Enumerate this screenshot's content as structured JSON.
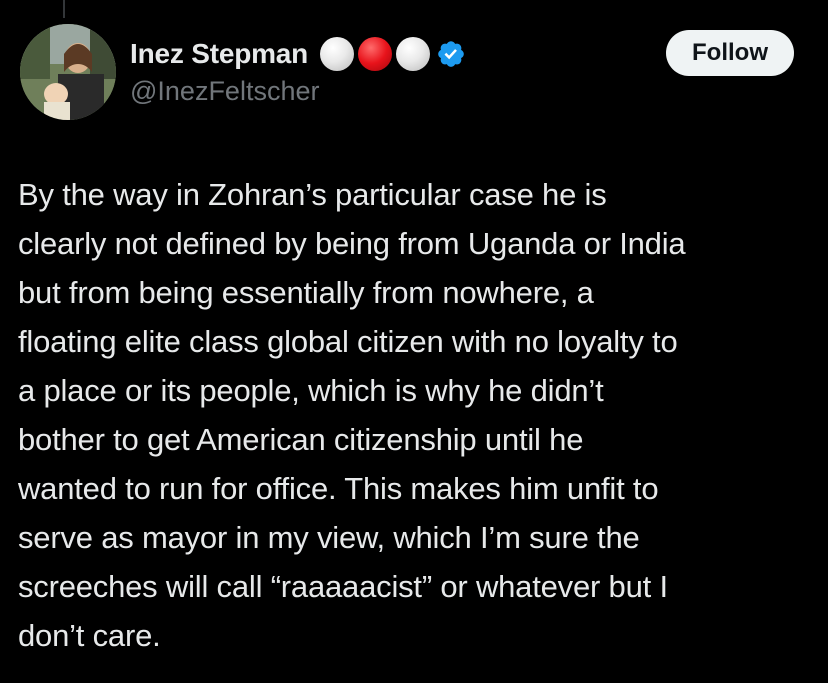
{
  "author": {
    "display_name": "Inez Stepman",
    "handle": "@InezFeltscher",
    "name_emojis": [
      "white-circle",
      "red-circle",
      "white-circle"
    ],
    "verified": true
  },
  "follow_label": "Follow",
  "tweet": {
    "lines": [
      "By the way in Zohran’s particular case he is",
      "clearly not defined by being from Uganda or India",
      "but from being essentially from nowhere, a",
      "floating elite class global citizen with no loyalty to",
      "a place or its people, which is why he didn’t",
      "bother to get American citizenship until he",
      "wanted to run for office. This makes him unfit to",
      "serve as mayor in my view, which I’m sure the",
      "screeches will call “raaaaacist” or whatever but I",
      "don’t care."
    ]
  },
  "colors": {
    "background": "#000000",
    "text": "#e7e9ea",
    "secondary_text": "#71767b",
    "verified_badge": "#1d9bf0",
    "follow_button_bg": "#eff3f4",
    "follow_button_text": "#0f1419"
  },
  "icons": {
    "verified": "verified-badge-icon"
  }
}
